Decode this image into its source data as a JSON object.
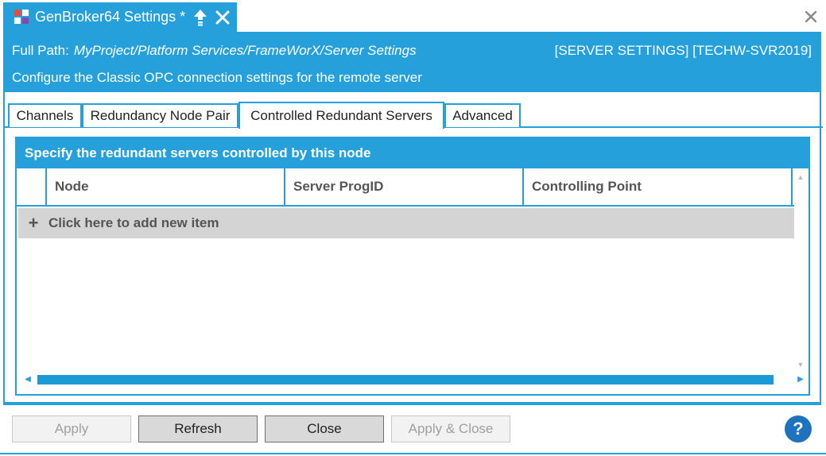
{
  "document_tab": {
    "title": "GenBroker64 Settings *",
    "pin_icon": "arrow-up-icon",
    "close_icon": "close-icon"
  },
  "window": {
    "close_icon": "close-icon"
  },
  "header": {
    "path_label": "Full Path:",
    "path_value": "MyProject/Platform Services/FrameWorX/Server Settings",
    "server_tag": "[SERVER SETTINGS] [TECHW-SVR2019]",
    "description": "Configure the Classic OPC connection settings for the remote server"
  },
  "tabs": [
    {
      "label": "Channels",
      "active": false
    },
    {
      "label": "Redundancy Node Pair",
      "active": false
    },
    {
      "label": "Controlled Redundant Servers",
      "active": true
    },
    {
      "label": "Advanced",
      "active": false
    }
  ],
  "grid": {
    "title": "Specify the redundant servers controlled by this node",
    "columns": [
      "Node",
      "Server ProgID",
      "Controlling Point"
    ],
    "add_item_label": "Click here to add new item",
    "rows": []
  },
  "footer": {
    "apply": "Apply",
    "refresh": "Refresh",
    "close": "Close",
    "apply_close": "Apply & Close",
    "help": "?"
  },
  "colors": {
    "accent": "#26a0da",
    "add_row_bg": "#d4d4d4",
    "help": "#1e73be"
  }
}
